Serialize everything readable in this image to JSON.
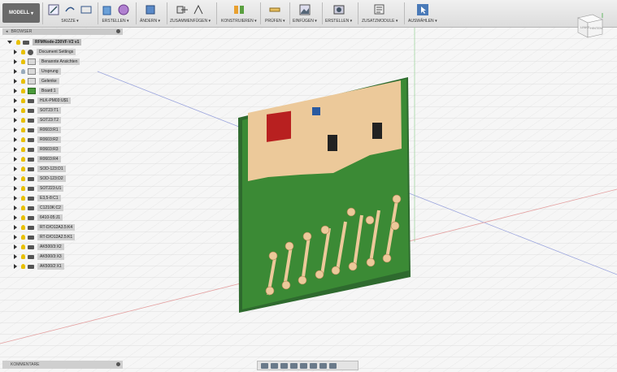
{
  "toolbar": {
    "mode": "MODELL",
    "groups": [
      {
        "label": "SKIZZE"
      },
      {
        "label": "ERSTELLEN"
      },
      {
        "label": "ÄNDERN"
      },
      {
        "label": "ZUSAMMENFÜGEN"
      },
      {
        "label": "KONSTRUIEREN"
      },
      {
        "label": "PRÜFEN"
      },
      {
        "label": "EINFÜGEN"
      },
      {
        "label": "ERSTELLEN"
      },
      {
        "label": "ZUSATZMODULE"
      },
      {
        "label": "AUSWÄHLEN"
      }
    ]
  },
  "browser": {
    "title": "BROWSER",
    "root": "RFMNode-230VF-V2 v1",
    "items": [
      {
        "label": "Document Settings",
        "icon": "gear"
      },
      {
        "label": "Benannte Ansichten",
        "icon": "folder"
      },
      {
        "label": "Ursprung",
        "icon": "folder"
      },
      {
        "label": "Gelenke",
        "icon": "folder"
      },
      {
        "label": "Board:1",
        "icon": "board"
      },
      {
        "label": "HLK-PM03:U$1",
        "icon": "component"
      },
      {
        "label": "SOT23:T1",
        "icon": "component"
      },
      {
        "label": "SOT23:T2",
        "icon": "component"
      },
      {
        "label": "R0603:R1",
        "icon": "component"
      },
      {
        "label": "R0603:R2",
        "icon": "component"
      },
      {
        "label": "R0603:R3",
        "icon": "component"
      },
      {
        "label": "R0603:R4",
        "icon": "component"
      },
      {
        "label": "SOD-123:D1",
        "icon": "component"
      },
      {
        "label": "SOD-123:D2",
        "icon": "component"
      },
      {
        "label": "SOT223:U1",
        "icon": "component"
      },
      {
        "label": "E3,5-8:C1",
        "icon": "component"
      },
      {
        "label": "C1210K:C2",
        "icon": "component"
      },
      {
        "label": "6410-05:J1",
        "icon": "component"
      },
      {
        "label": "RT-D/O12A3.5:K4",
        "icon": "component"
      },
      {
        "label": "RT-D/O12A2.5:K1",
        "icon": "component"
      },
      {
        "label": "AK500/3:X2",
        "icon": "component"
      },
      {
        "label": "AK500/3:X3",
        "icon": "component"
      },
      {
        "label": "AK500/2:X1",
        "icon": "component"
      }
    ]
  },
  "viewcube": {
    "left": "LINKS",
    "front": "HINTEN"
  },
  "comments": {
    "title": "KOMMENTARE"
  }
}
